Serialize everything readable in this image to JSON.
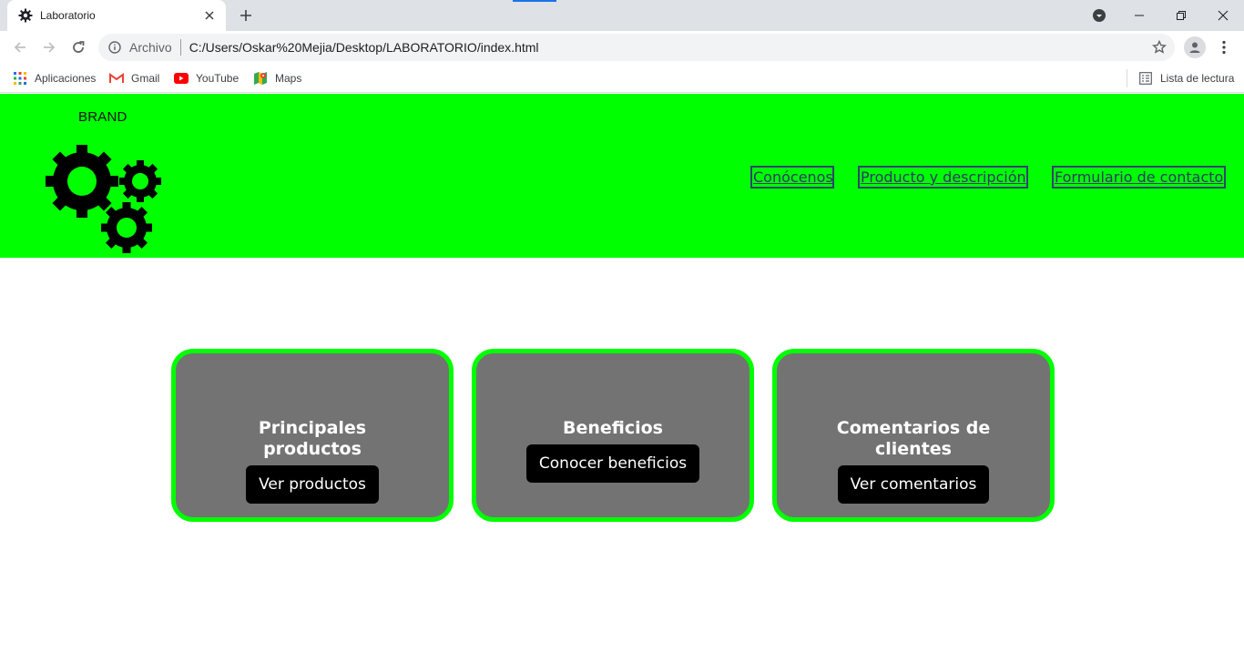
{
  "browser": {
    "tab_title": "Laboratorio",
    "omnibox_scheme": "Archivo",
    "url": "C:/Users/Oskar%20Mejia/Desktop/LABORATORIO/index.html",
    "bookmarks": [
      {
        "label": "Aplicaciones",
        "icon": "apps-grid-icon"
      },
      {
        "label": "Gmail",
        "icon": "gmail-icon"
      },
      {
        "label": "YouTube",
        "icon": "youtube-icon"
      },
      {
        "label": "Maps",
        "icon": "maps-icon"
      }
    ],
    "reading_list": "Lista de lectura"
  },
  "site": {
    "brand": "BRAND",
    "nav": [
      {
        "label": "Conócenos"
      },
      {
        "label": "Producto y descripción"
      },
      {
        "label": "Formulario de contacto"
      }
    ],
    "cards": [
      {
        "title_line1": "Principales",
        "title_line2": "productos",
        "button": "Ver productos"
      },
      {
        "title_line1": "Beneficios",
        "title_line2": "",
        "button": "Conocer beneficios"
      },
      {
        "title_line1": "Comentarios de",
        "title_line2": "clientes",
        "button": "Ver comentarios"
      }
    ]
  },
  "colors": {
    "header_bg": "#00ff00",
    "card_bg": "#737373",
    "card_border": "#00ff00",
    "button_bg": "#000000",
    "nav_link": "#2c3a66"
  }
}
